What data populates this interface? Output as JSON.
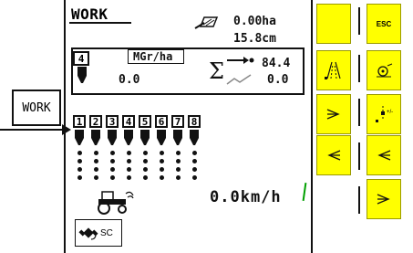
{
  "screen_title": "WORK",
  "area_value": "0.00ha",
  "distance_value": "15.8cm",
  "rate": {
    "section_number": "4",
    "unit": "MGr/ha",
    "value": "0.0"
  },
  "sum": {
    "value_top": "84.4",
    "value_bottom": "0.0"
  },
  "callout_label": "WORK",
  "sections": [
    "1",
    "2",
    "3",
    "4",
    "5",
    "6",
    "7",
    "8"
  ],
  "speed": "0.0km/h",
  "gps_status": "SC",
  "softkeys_left": [
    {
      "name": "softkey-left-1-blank-yellow",
      "icon": ""
    },
    {
      "name": "softkey-tramline-icon",
      "icon": "tramline-icon"
    },
    {
      "name": "softkey-arrow-right-icon",
      "icon": "arrow-right-icon"
    },
    {
      "name": "softkey-arrow-left-icon",
      "icon": "arrow-left-icon"
    },
    {
      "name": "softkey-left-5-blank",
      "icon": ""
    }
  ],
  "softkeys_right": [
    {
      "name": "esc-button",
      "label": "ESC"
    },
    {
      "name": "softkey-rotor-icon",
      "icon": "rotor-icon"
    },
    {
      "name": "softkey-marker-icon",
      "icon": "marker-icon"
    },
    {
      "name": "softkey-arrow-left-2-icon",
      "icon": "arrow-left-icon"
    },
    {
      "name": "softkey-arrow-right-2-icon",
      "icon": "arrow-right-icon"
    }
  ],
  "colors": {
    "softkey": "#ffff00",
    "ink": "#111111",
    "speed_bar": "#00a000"
  }
}
